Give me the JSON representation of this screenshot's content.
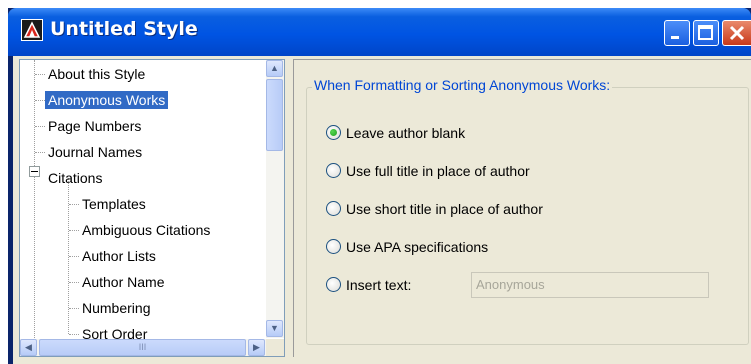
{
  "window": {
    "title": "Untitled Style"
  },
  "tree": {
    "items": [
      {
        "label": "About this Style"
      },
      {
        "label": "Anonymous Works"
      },
      {
        "label": "Page Numbers"
      },
      {
        "label": "Journal Names"
      },
      {
        "label": "Citations"
      },
      {
        "label": "Templates"
      },
      {
        "label": "Ambiguous Citations"
      },
      {
        "label": "Author Lists"
      },
      {
        "label": "Author Name"
      },
      {
        "label": "Numbering"
      },
      {
        "label": "Sort Order"
      }
    ],
    "selected": "Anonymous Works",
    "scroll_up": "▲",
    "scroll_down": "▼",
    "scroll_left": "◀",
    "scroll_right": "▶",
    "grip": "III"
  },
  "panel": {
    "group_title": "When Formatting or Sorting Anonymous Works:",
    "options": [
      {
        "label": "Leave author blank",
        "checked": true
      },
      {
        "label": "Use full title in place of author",
        "checked": false
      },
      {
        "label": "Use short title in place of author",
        "checked": false
      },
      {
        "label": "Use APA specifications",
        "checked": false
      },
      {
        "label": "Insert text:",
        "checked": false
      }
    ],
    "insert_text_value": "Anonymous"
  },
  "colors": {
    "titlebar": "#0054e3",
    "selection": "#316ac5",
    "group_title": "#0046d5"
  }
}
